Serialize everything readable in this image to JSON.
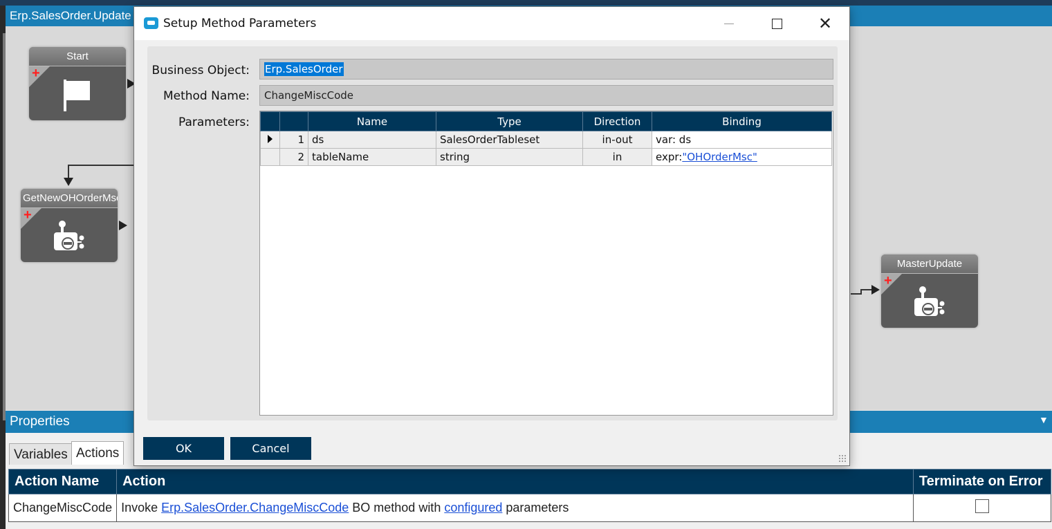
{
  "designer": {
    "doc_tab": "Erp.SalesOrder.Update",
    "nodes": {
      "start": "Start",
      "get_new": "GetNewOHOrderMsc",
      "master_update": "MasterUpdate"
    }
  },
  "properties": {
    "title": "Properties",
    "tabs": [
      {
        "label": "Variables",
        "active": false
      },
      {
        "label": "Actions",
        "active": true
      }
    ],
    "columns": [
      "Action Name",
      "Action",
      "Terminate on Error"
    ],
    "rows": [
      {
        "name": "ChangeMiscCode",
        "action_prefix": "Invoke ",
        "action_link1": "Erp.SalesOrder.ChangeMiscCode",
        "action_mid": " BO method with ",
        "action_link2": "configured",
        "action_suffix": " parameters",
        "terminate_on_error": false
      }
    ]
  },
  "dialog": {
    "title": "Setup Method Parameters",
    "business_object_label": "Business Object:",
    "business_object_value": "Erp.SalesOrder",
    "method_name_label": "Method Name:",
    "method_name_value": "ChangeMiscCode",
    "parameters_label": "Parameters:",
    "columns": [
      "Name",
      "Type",
      "Direction",
      "Binding"
    ],
    "rows": [
      {
        "index": "1",
        "name": "ds",
        "type": "SalesOrderTableset",
        "direction": "in-out",
        "binding_prefix": "var: ds",
        "binding_link": ""
      },
      {
        "index": "2",
        "name": "tableName",
        "type": "string",
        "direction": "in",
        "binding_prefix": "expr:",
        "binding_link": "\"OHOrderMsc\""
      }
    ],
    "ok_label": "OK",
    "cancel_label": "Cancel"
  },
  "colors": {
    "header_navy": "#003659",
    "accent_blue": "#1b7fb6",
    "link_blue": "#1a4fd6"
  }
}
